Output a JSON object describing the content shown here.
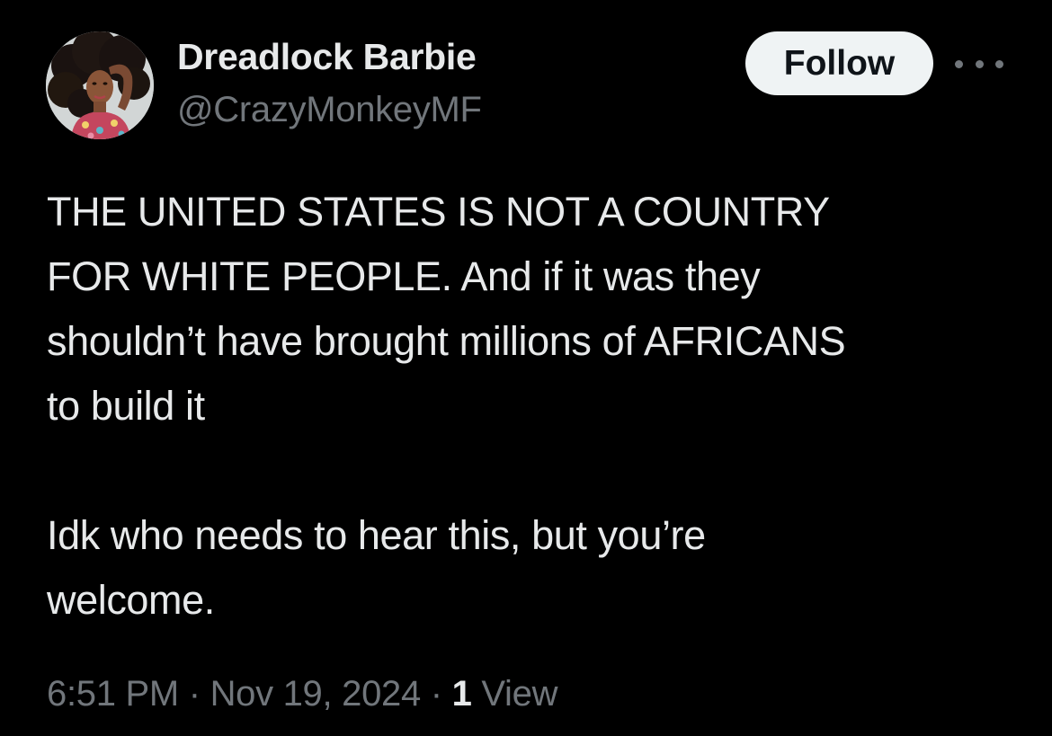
{
  "author": {
    "display_name": "Dreadlock Barbie",
    "handle": "@CrazyMonkeyMF",
    "avatar_icon": "doll-profile-photo"
  },
  "actions": {
    "follow_label": "Follow",
    "more_icon": "ellipsis-icon"
  },
  "tweet": {
    "paragraph_1": "THE UNITED STATES IS NOT A COUNTRY\nFOR WHITE PEOPLE. And if it was they\nshouldn’t have brought millions of AFRICANS\nto build it",
    "paragraph_2": "Idk who needs to hear this, but you’re\nwelcome."
  },
  "meta": {
    "time": "6:51 PM",
    "separator": "·",
    "date": "Nov 19, 2024",
    "views_count": "1",
    "views_label": "View"
  },
  "colors": {
    "background": "#000000",
    "primary_text": "#e7e9ea",
    "secondary_text": "#71767b",
    "follow_button_bg": "#eff3f4",
    "follow_button_text": "#0f1419"
  }
}
